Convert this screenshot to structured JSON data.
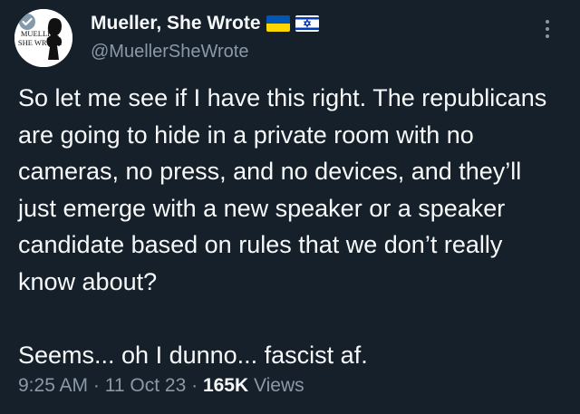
{
  "tweet": {
    "author": {
      "display_name": "Mueller, She Wrote",
      "handle": "@MuellerSheWrote",
      "avatar_text_line1": "MUELLER,",
      "avatar_text_line2": "SHE WROTE",
      "flags": [
        "ukraine-flag",
        "israel-flag"
      ]
    },
    "paragraphs": [
      "So let me see if I have this right. The republicans are going to hide in a private room with no cameras, no press, and no devices, and they’ll just emerge with a new speaker or a speaker candidate based on rules that we don’t really know about?",
      "Seems... oh I dunno... fascist af."
    ],
    "meta": {
      "time": "9:25 AM",
      "separator": "·",
      "date": "11 Oct 23",
      "views_count": "165K",
      "views_label": "Views"
    }
  },
  "colors": {
    "background": "#15202b",
    "text_primary": "#f7f9f9",
    "text_secondary": "#8b98a5",
    "verified_badge": "#829aab",
    "ukraine_blue": "#0057b7",
    "ukraine_yellow": "#ffd700",
    "israel_blue": "#0038b8"
  }
}
